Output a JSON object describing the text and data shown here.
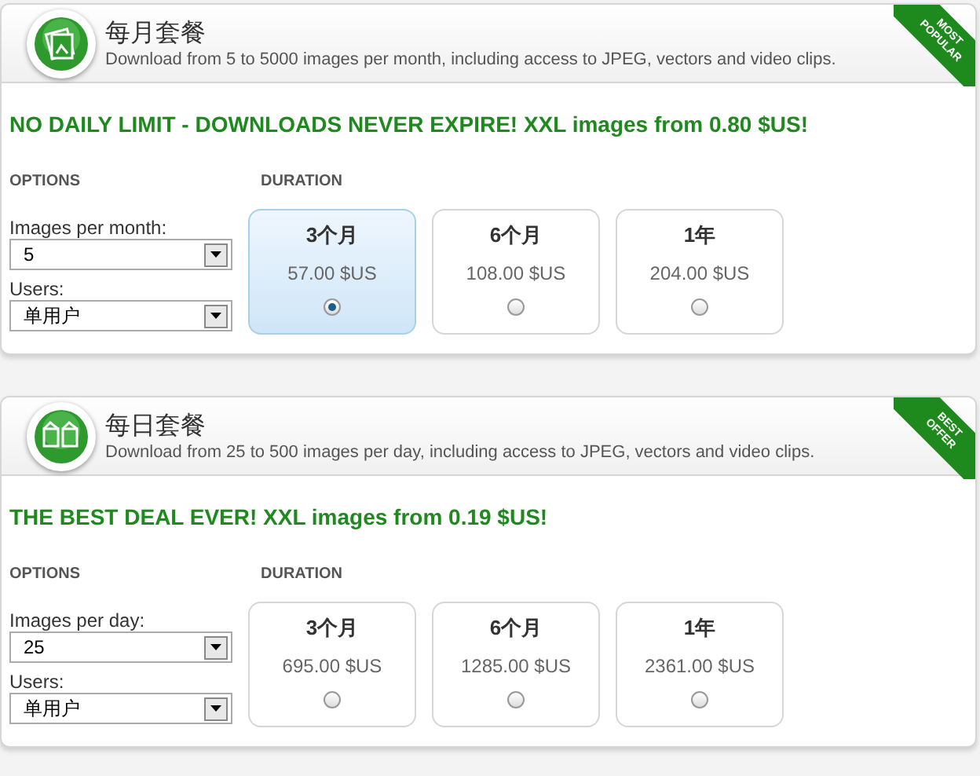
{
  "plans": [
    {
      "kind": "month",
      "title": "每月套餐",
      "subtitle": "Download from 5 to 5000 images per month, including access to JPEG, vectors and video clips.",
      "ribbon": "MOST POPULAR",
      "banner": "NO DAILY LIMIT - DOWNLOADS NEVER EXPIRE! XXL images from 0.80 $US!",
      "options_heading": "OPTIONS",
      "duration_heading": "DURATION",
      "quantity_label": "Images per month:",
      "quantity_value": "5",
      "users_label": "Users:",
      "users_value": "单用户",
      "durations": [
        {
          "label": "3个月",
          "price": "57.00 $US",
          "selected": true
        },
        {
          "label": "6个月",
          "price": "108.00 $US",
          "selected": false
        },
        {
          "label": "1年",
          "price": "204.00 $US",
          "selected": false
        }
      ]
    },
    {
      "kind": "day",
      "title": "每日套餐",
      "subtitle": "Download from 25 to 500 images per day, including access to JPEG, vectors and video clips.",
      "ribbon": "BEST OFFER",
      "banner": "THE BEST DEAL EVER! XXL images from 0.19 $US!",
      "options_heading": "OPTIONS",
      "duration_heading": "DURATION",
      "quantity_label": "Images per day:",
      "quantity_value": "25",
      "users_label": "Users:",
      "users_value": "单用户",
      "durations": [
        {
          "label": "3个月",
          "price": "695.00 $US",
          "selected": false
        },
        {
          "label": "6个月",
          "price": "1285.00 $US",
          "selected": false
        },
        {
          "label": "1年",
          "price": "2361.00 $US",
          "selected": false
        }
      ]
    }
  ]
}
